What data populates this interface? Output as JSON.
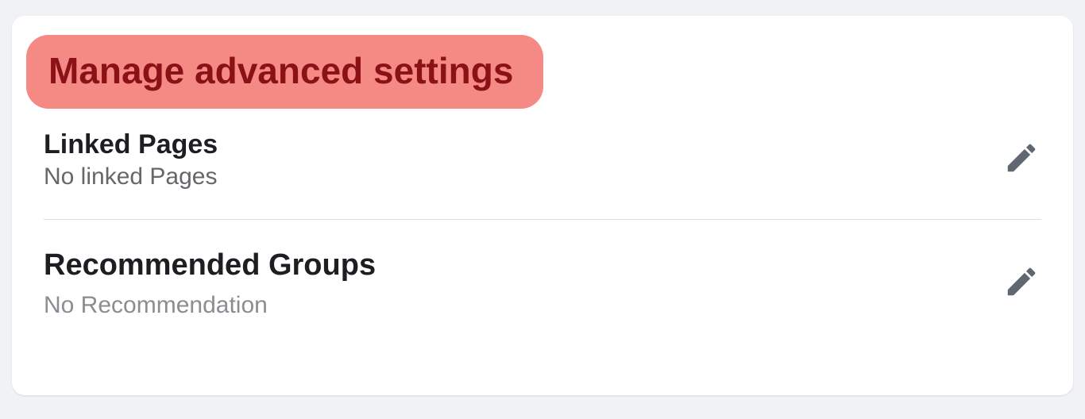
{
  "header": {
    "title": "Manage advanced settings"
  },
  "settings": [
    {
      "title": "Linked Pages",
      "subtitle": "No linked Pages"
    },
    {
      "title": "Recommended Groups",
      "subtitle": "No Recommendation"
    }
  ]
}
